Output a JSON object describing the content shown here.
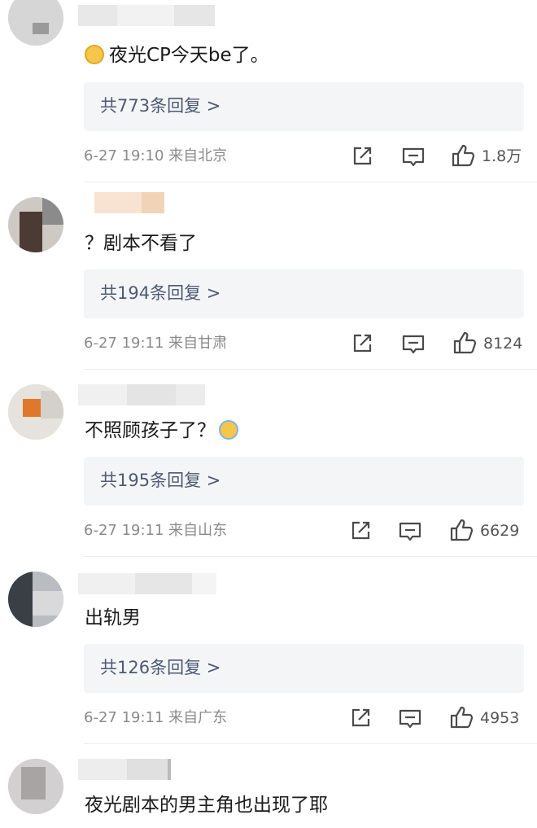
{
  "colors": {
    "reply_box_bg": "#f4f5f7",
    "reply_text": "#4d5a73",
    "meta_text": "#8a8a8a",
    "icon_stroke": "#4a4a4a"
  },
  "icons": {
    "share": "share-icon",
    "comment": "comment-icon",
    "like": "thumbs-up-icon"
  },
  "comments": [
    {
      "text": "夜光CP今天be了。",
      "leading_emoji": "crying-face-emoji",
      "replies_label": "共773条回复 >",
      "meta": "6-27 19:10 来自北京",
      "likes": "1.8万"
    },
    {
      "text": "？剧本不看了",
      "replies_label": "共194条回复 >",
      "meta": "6-27 19:11 来自甘肃",
      "likes": "8124"
    },
    {
      "text": "不照顾孩子了？",
      "trailing_emoji": "hands-on-head-emoji",
      "replies_label": "共195条回复 >",
      "meta": "6-27 19:11 来自山东",
      "likes": "6629"
    },
    {
      "text": "出轨男",
      "replies_label": "共126条回复 >",
      "meta": "6-27 19:11 来自广东",
      "likes": "4953"
    },
    {
      "text": "夜光剧本的男主角也出现了耶"
    }
  ]
}
